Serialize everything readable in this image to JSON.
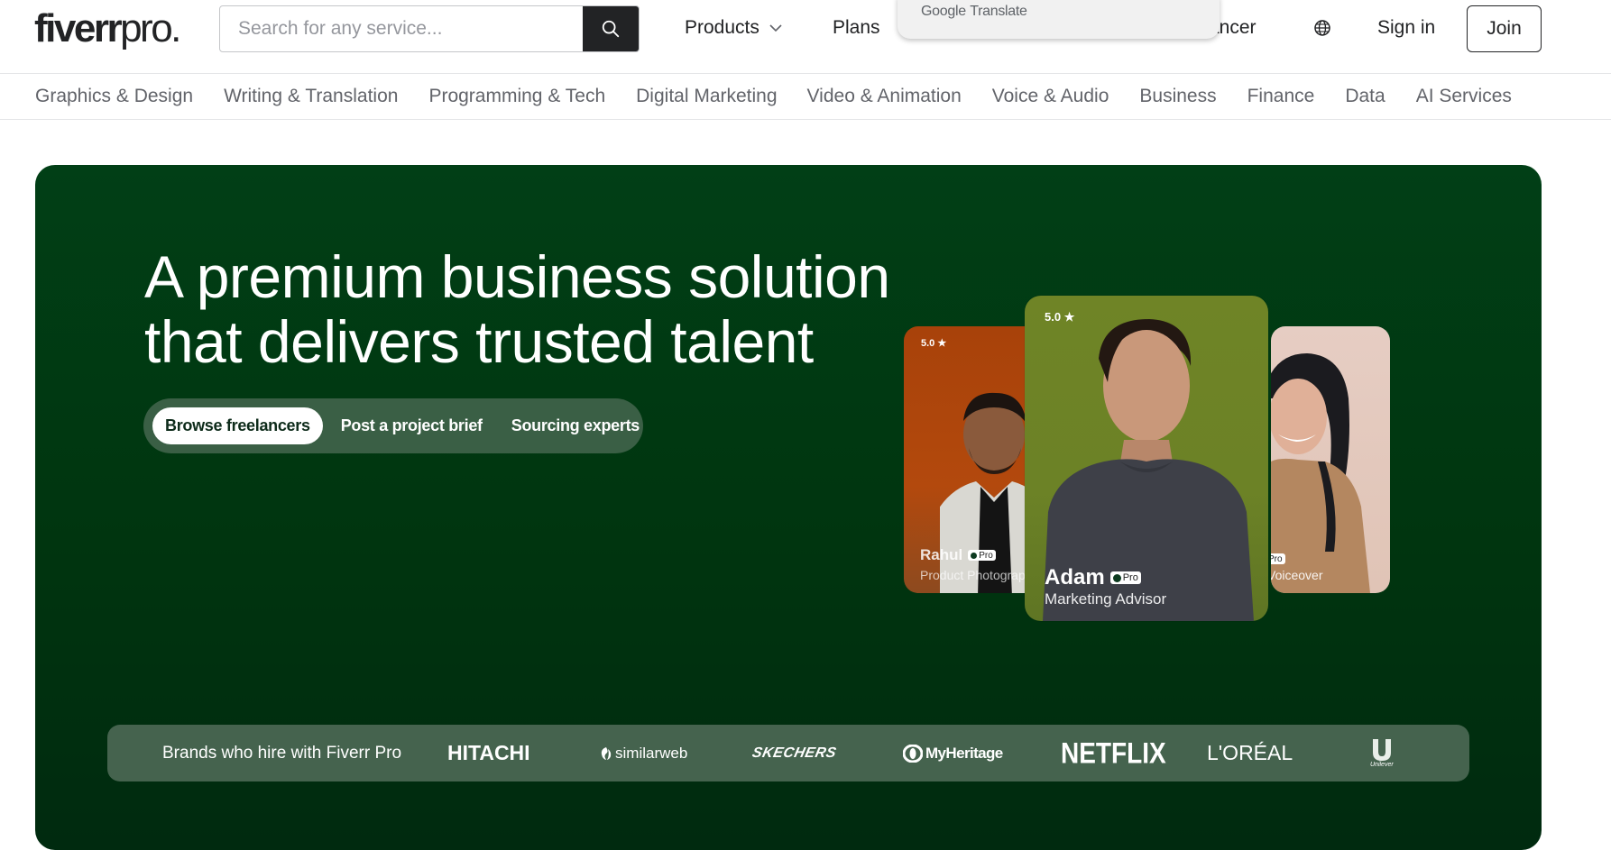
{
  "header": {
    "logo_main": "fiverr",
    "logo_suffix": "pro.",
    "search_placeholder": "Search for any service...",
    "search_value": "",
    "search_icon": "search-icon",
    "nav": {
      "products": "Products",
      "plans": "Plans",
      "freelancer_partial": "ancer",
      "globe_icon": "globe-icon",
      "sign_in": "Sign in",
      "join": "Join"
    },
    "translate_popup": {
      "brand": "Google",
      "product": "Translate"
    }
  },
  "categories": [
    "Graphics & Design",
    "Writing & Translation",
    "Programming & Tech",
    "Digital Marketing",
    "Video & Animation",
    "Voice & Audio",
    "Business",
    "Finance",
    "Data",
    "AI Services"
  ],
  "hero": {
    "title_line1": "A premium business solution",
    "title_line2": "that delivers trusted talent",
    "tabs": [
      {
        "label": "Browse freelancers",
        "active": true
      },
      {
        "label": "Post a project brief",
        "active": false
      },
      {
        "label": "Sourcing experts",
        "active": false
      }
    ],
    "cards": {
      "left": {
        "rating": "5.0",
        "name": "Rahul",
        "badge": "Pro",
        "role": "Product Photograp"
      },
      "center": {
        "rating": "5.0",
        "name": "Adam",
        "badge": "Pro",
        "role": "Marketing Advisor"
      },
      "right": {
        "badge": "Pro",
        "role": "Voiceover"
      }
    },
    "colors": {
      "hero_bg": "#013f16",
      "tabs_bg": "#3a5f45",
      "brands_bg": "#45634e",
      "card_left_bg": "#a8420a",
      "card_center_bg": "#6f8426",
      "card_right_bg": "#e6cdc3"
    }
  },
  "brands": {
    "label": "Brands who hire with Fiverr Pro",
    "logos": {
      "hitachi": "HITACHI",
      "similarweb": "similarweb",
      "skechers": "SKECHERS",
      "myheritage": "MyHeritage",
      "netflix": "NETFLIX",
      "loreal": "L'ORÉAL",
      "unilever": "Unilever"
    }
  }
}
